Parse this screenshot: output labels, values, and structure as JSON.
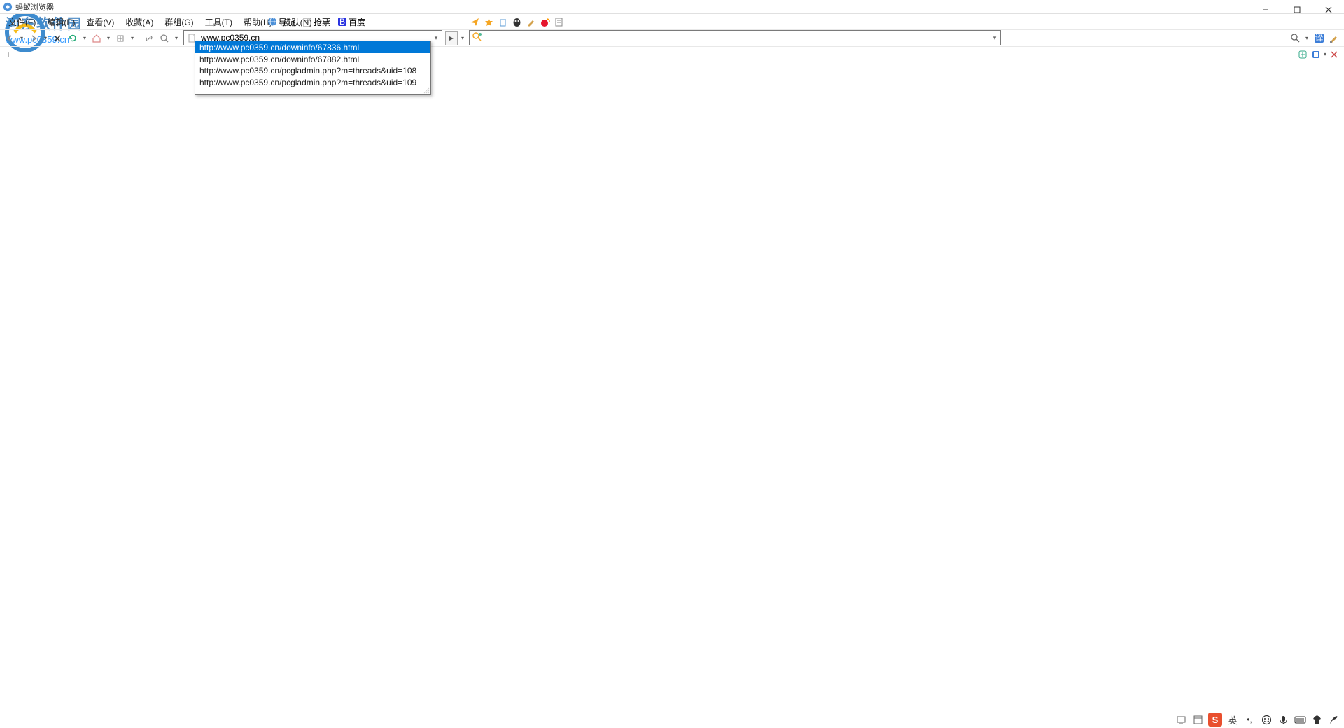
{
  "app": {
    "title": "蚂蚁浏览器"
  },
  "menu": {
    "file": "文件(F)",
    "edit": "编辑(E)",
    "view": "查看(V)",
    "fav": "收藏(A)",
    "group": "群组(G)",
    "tools": "工具(T)",
    "help": "帮助(H)",
    "skin": "皮肤(N)"
  },
  "quick_links": {
    "nav": "导航",
    "ticket": "抢票",
    "baidu": "百度"
  },
  "address": {
    "value": "www.pc0359.cn"
  },
  "history": [
    "http://www.pc0359.cn/downinfo/67836.html",
    "http://www.pc0359.cn/downinfo/67882.html",
    "http://www.pc0359.cn/pcgladmin.php?m=threads&uid=108",
    "http://www.pc0359.cn/pcgladmin.php?m=threads&uid=109"
  ],
  "watermark": {
    "brand": "河东软件园",
    "url": "www.pc0359.cn"
  },
  "ime": {
    "lang": "英",
    "s": "S"
  },
  "window": {
    "min": "—",
    "max": "□",
    "close": "✕"
  }
}
